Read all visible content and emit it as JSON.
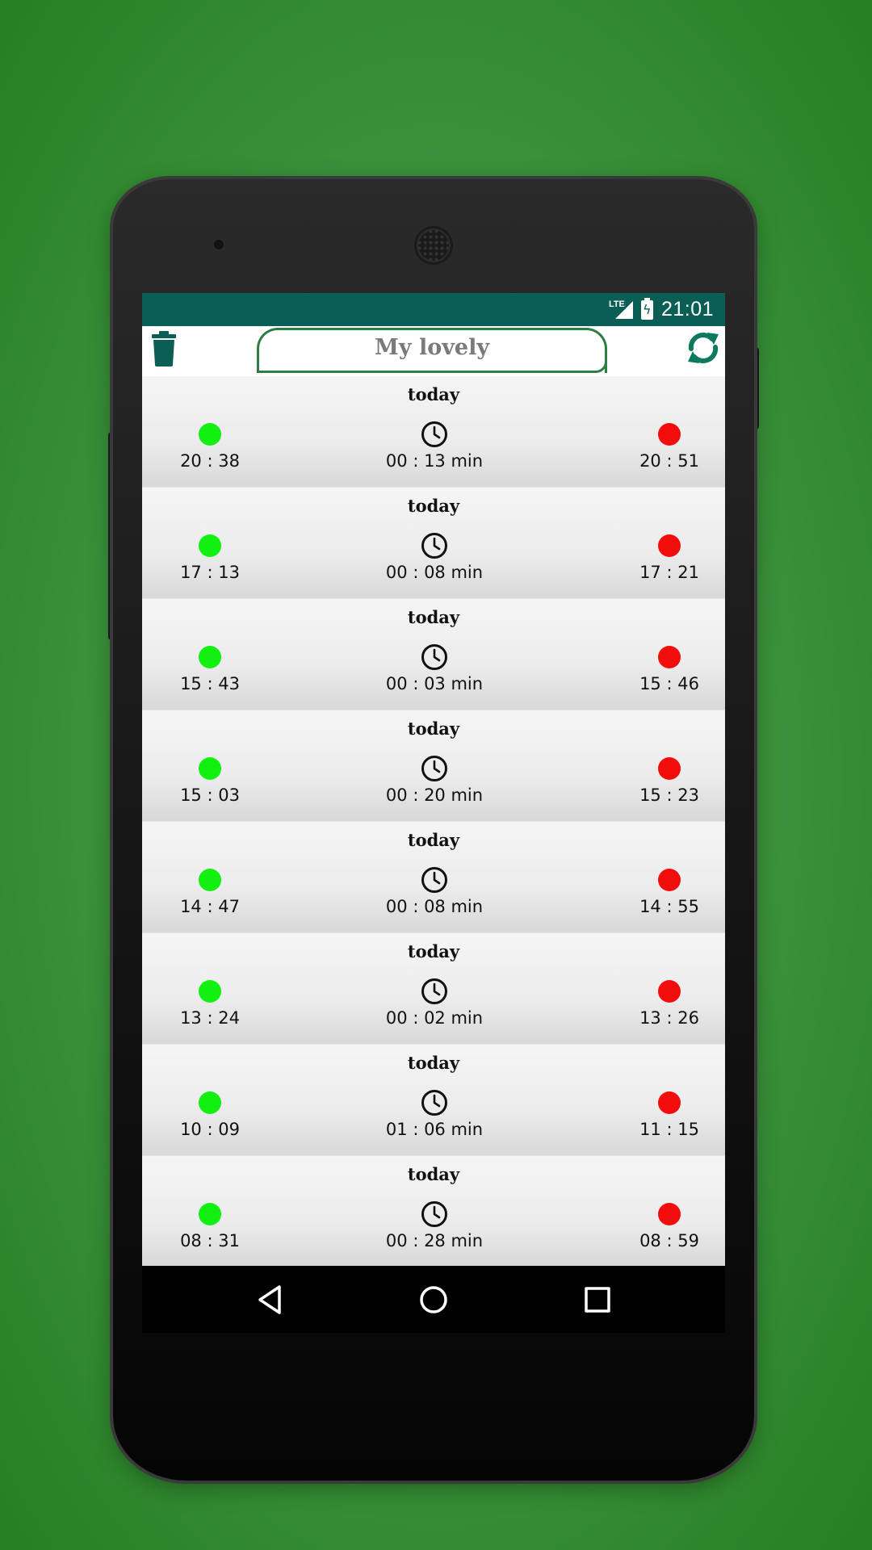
{
  "status_bar": {
    "network_label": "LTE",
    "time": "21:01",
    "color": "#0b5e55"
  },
  "app_bar": {
    "title": "My lovely",
    "left_icon": "trash-icon",
    "right_icon": "refresh-icon",
    "accent_color": "#2e7d42"
  },
  "sessions": [
    {
      "day": "today",
      "start": "20 : 38",
      "duration": "00 : 13 min",
      "end": "20 : 51"
    },
    {
      "day": "today",
      "start": "17 : 13",
      "duration": "00 : 08 min",
      "end": "17 : 21"
    },
    {
      "day": "today",
      "start": "15 : 43",
      "duration": "00 : 03 min",
      "end": "15 : 46"
    },
    {
      "day": "today",
      "start": "15 : 03",
      "duration": "00 : 20 min",
      "end": "15 : 23"
    },
    {
      "day": "today",
      "start": "14 : 47",
      "duration": "00 : 08 min",
      "end": "14 : 55"
    },
    {
      "day": "today",
      "start": "13 : 24",
      "duration": "00 : 02 min",
      "end": "13 : 26"
    },
    {
      "day": "today",
      "start": "10 : 09",
      "duration": "01 : 06 min",
      "end": "11 : 15"
    },
    {
      "day": "today",
      "start": "08 : 31",
      "duration": "00 : 28 min",
      "end": "08 : 59"
    }
  ],
  "status_colors": {
    "start": "#12f012",
    "end": "#f20c0c"
  },
  "nav_bar": {
    "buttons": [
      "back-icon",
      "home-icon",
      "recents-icon"
    ]
  }
}
